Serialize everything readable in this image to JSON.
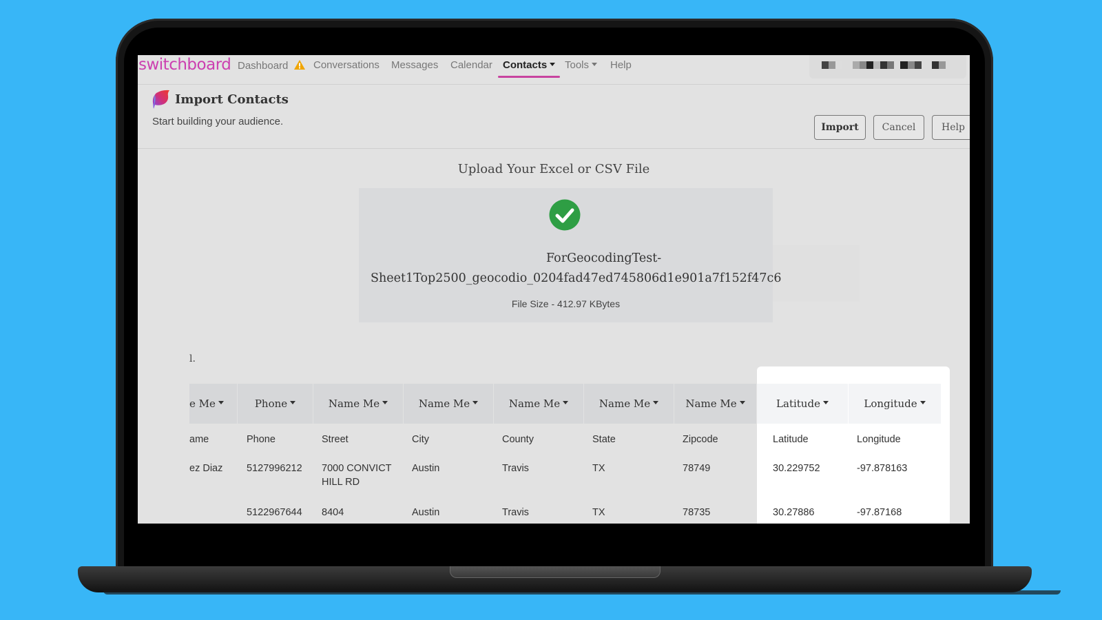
{
  "navbar": {
    "brand": "switchboard",
    "items": [
      {
        "label": "Dashboard",
        "icon": "warning-icon"
      },
      {
        "label": "Conversations"
      },
      {
        "label": "Messages"
      },
      {
        "label": "Calendar"
      },
      {
        "label": "Contacts",
        "active": true,
        "dropdown": true
      },
      {
        "label": "Tools",
        "dropdown": true
      },
      {
        "label": "Help"
      }
    ],
    "accent_color": "#c8439f",
    "brand_color": "#cc3fb0"
  },
  "page": {
    "title": "Import Contacts",
    "subtitle": "Start building your audience.",
    "buttons": {
      "import": "Import",
      "cancel": "Cancel",
      "help": "Help"
    }
  },
  "upload": {
    "title": "Upload Your Excel or CSV File",
    "status_icon": "check-circle-icon",
    "status_color": "#2e9e44",
    "file_name_line1": "ForGeocodingTest-",
    "file_name_line2": "Sheet1Top2500_geocodio_0204fad47ed745806d1e901a7f152f47c6",
    "file_size": "File Size - 412.97 KBytes"
  },
  "partial_text": "l.",
  "table": {
    "mapping_headers": [
      "e Me",
      "Phone",
      "Name Me",
      "Name Me",
      "Name Me",
      "Name Me",
      "Name Me",
      "Latitude",
      "Longitude"
    ],
    "column_names": [
      "ame",
      "Phone",
      "Street",
      "City",
      "County",
      "State",
      "Zipcode",
      "Latitude",
      "Longitude"
    ],
    "rows": [
      [
        "ez Diaz",
        "5127996212",
        "7000 CONVICT HILL RD",
        "Austin",
        "Travis",
        "TX",
        "78749",
        "30.229752",
        "-97.878163"
      ],
      [
        "",
        "5122967644",
        "8404",
        "Austin",
        "Travis",
        "TX",
        "78735",
        "30.27886",
        "-97.87168"
      ]
    ]
  }
}
